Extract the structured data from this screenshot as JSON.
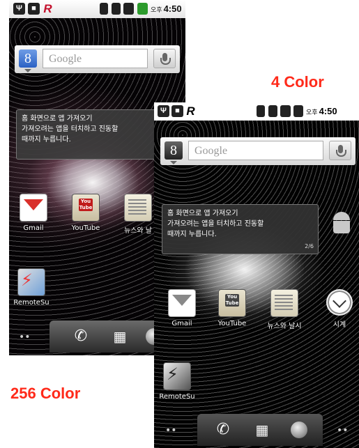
{
  "captions": {
    "color4": "4 Color",
    "color256": "256 Color"
  },
  "colors": {
    "caption": "#ff2a1a"
  },
  "screen_256": {
    "status": {
      "icons": [
        "usb-icon",
        "android-debug-icon",
        "r-app-icon",
        "sd-card-icon",
        "vibrate-icon",
        "signal-icon",
        "battery-icon"
      ],
      "ampm": "오후",
      "time": "4:50"
    },
    "search": {
      "logo": "8",
      "placeholder": "Google"
    },
    "tooltip": {
      "line1": "홈 화면으로 앱 가져오기",
      "line2": "가져오려는 앱을 터치하고 진동할",
      "line3": "때까지 누릅니다."
    },
    "apps": [
      {
        "label": "Gmail"
      },
      {
        "label": "YouTube"
      },
      {
        "label": "뉴스와 날"
      },
      {
        "label": "RemoteSu"
      }
    ],
    "dock": {
      "dots_left": "••"
    }
  },
  "screen_4": {
    "status": {
      "ampm": "오후",
      "time": "4:50"
    },
    "search": {
      "logo": "8",
      "placeholder": "Google"
    },
    "tooltip": {
      "line1": "홈 화면으로 앱 가져오기",
      "line2": "가져오려는 앱을 터치하고 진동할",
      "line3": "때까지 누릅니다.",
      "page": "2/6"
    },
    "apps": [
      {
        "label": "Gmail"
      },
      {
        "label": "YouTube"
      },
      {
        "label": "뉴스와 날시"
      },
      {
        "label": "시계"
      },
      {
        "label": "RemoteSu"
      }
    ],
    "dock": {
      "dots_left": "••",
      "dots_right": "••"
    }
  }
}
